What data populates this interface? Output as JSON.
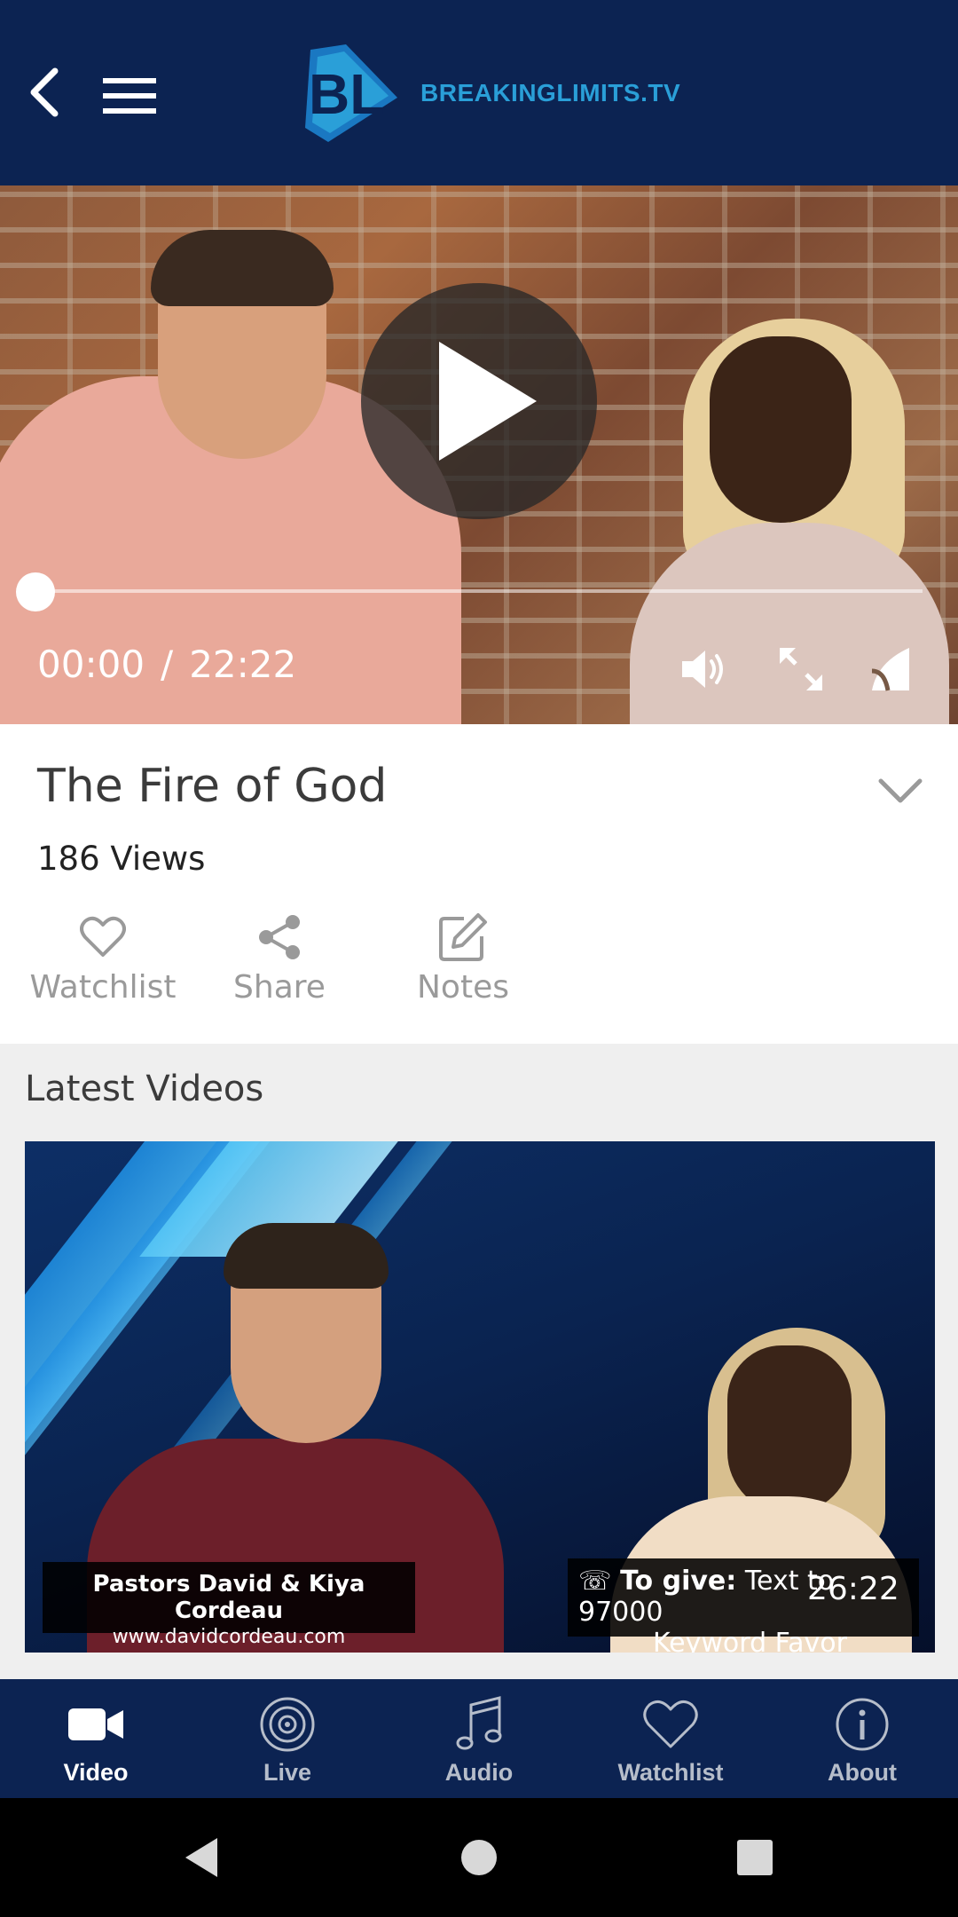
{
  "header": {
    "logo_text": "BREAKINGLIMITS.TV",
    "logo_mark": "BL",
    "colors": {
      "bar": "#0c2352",
      "brand_blue": "#2a9fd8"
    }
  },
  "player": {
    "current_time": "00:00",
    "separator": "/",
    "duration": "22:22",
    "progress": 0
  },
  "video": {
    "title": "The Fire of God",
    "views": "186 Views"
  },
  "actions": [
    {
      "label": "Watchlist",
      "icon": "heart-icon"
    },
    {
      "label": "Share",
      "icon": "share-icon"
    },
    {
      "label": "Notes",
      "icon": "edit-icon"
    }
  ],
  "latest": {
    "title": "Latest Videos",
    "items": [
      {
        "duration": "26:22",
        "caption_name": "Pastors David & Kiya Cordeau",
        "caption_url": "www.davidcordeau.com",
        "give_label": "To give:",
        "give_text": "Text to 97000",
        "give_keyword": "Keyword Favor"
      }
    ]
  },
  "bottom_nav": [
    {
      "label": "Video",
      "icon": "video-camera-icon",
      "active": true
    },
    {
      "label": "Live",
      "icon": "live-broadcast-icon",
      "active": false
    },
    {
      "label": "Audio",
      "icon": "music-note-icon",
      "active": false
    },
    {
      "label": "Watchlist",
      "icon": "heart-icon",
      "active": false
    },
    {
      "label": "About",
      "icon": "info-icon",
      "active": false
    }
  ]
}
